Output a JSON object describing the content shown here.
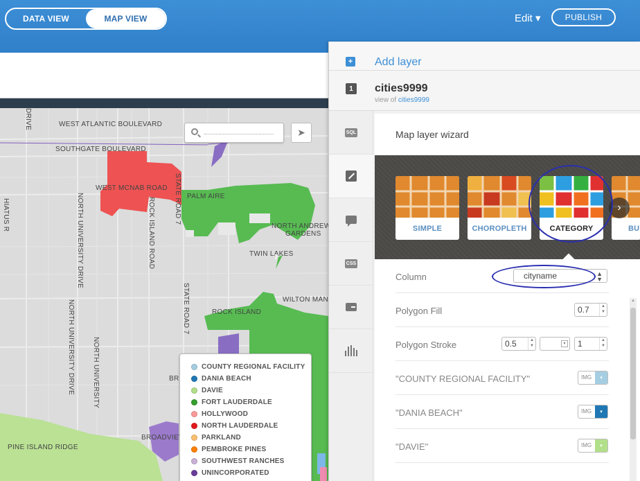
{
  "header": {
    "data_view": "DATA VIEW",
    "map_view": "MAP VIEW",
    "edit": "Edit ▾",
    "publish": "PUBLISH"
  },
  "map": {
    "labels": {
      "west_atlantic": "WEST ATLANTIC BOULEVARD",
      "southgate": "SOUTHGATE BOULEVARD",
      "west_mcnab": "WEST MCNAB ROAD",
      "palm_aire": "PALM AIRE",
      "north_andrews_1": "NORTH ANDREWS",
      "north_andrews_2": "GARDENS",
      "twin_lakes": "TWIN LAKES",
      "wilton_manors": "WILTON MAN",
      "rock_island": "ROCK ISLAND",
      "broadview": "BROADVIEW",
      "pine_island": "PINE ISLAND RIDGE",
      "bro": "BRO",
      "drive": "DRIVE",
      "nw_dr_left": "HIATUS R",
      "rock_island_road": "ROCK ISLAND ROAD",
      "state_road_7_a": "STATE ROAD 7",
      "state_road_7_b": "STATE ROAD 7",
      "north_university_1": "NORTH UNIVERSITY DRIVE",
      "north_university_2": "NORTH UNIVERSITY DRIVE",
      "north_university_3": "NORTH UNIVERSITY",
      "road_7": "7"
    },
    "search_placeholder": "",
    "legend": [
      {
        "label": "COUNTY REGIONAL FACILITY",
        "color": "#a6cee3"
      },
      {
        "label": "DANIA BEACH",
        "color": "#1f78b4"
      },
      {
        "label": "DAVIE",
        "color": "#b2df8a"
      },
      {
        "label": "FORT LAUDERDALE",
        "color": "#33a02c"
      },
      {
        "label": "HOLLYWOOD",
        "color": "#fb9a99"
      },
      {
        "label": "NORTH LAUDERDALE",
        "color": "#e31a1c"
      },
      {
        "label": "PARKLAND",
        "color": "#fdbf6f"
      },
      {
        "label": "PEMBROKE PINES",
        "color": "#ff7f00"
      },
      {
        "label": "SOUTHWEST RANCHES",
        "color": "#cab2d6"
      },
      {
        "label": "UNINCORPORATED",
        "color": "#6a3d9a"
      }
    ]
  },
  "panel": {
    "add_layer": "Add layer",
    "layer_number": "1",
    "layer_name": "cities9999",
    "view_of": "view of",
    "view_of_link": "cities9999",
    "tabs": {
      "sql": "SQL",
      "css": "CSS"
    },
    "wizard_title": "Map layer wizard",
    "viz_types": [
      {
        "label": "SIMPLE"
      },
      {
        "label": "CHOROPLETH"
      },
      {
        "label": "CATEGORY"
      },
      {
        "label": "BU"
      }
    ],
    "column_label": "Column",
    "column_value": "cityname",
    "polygon_fill_label": "Polygon Fill",
    "polygon_fill_value": "0.7",
    "polygon_stroke_label": "Polygon Stroke",
    "stroke_width": "0.5",
    "stroke_opacity": "1",
    "img_text": "IMG",
    "categories": [
      {
        "label": "\"COUNTY REGIONAL FACILITY\"",
        "color": "#a6cee3"
      },
      {
        "label": "\"DANIA BEACH\"",
        "color": "#1f78b4"
      },
      {
        "label": "\"DAVIE\"",
        "color": "#b2df8a"
      }
    ]
  }
}
